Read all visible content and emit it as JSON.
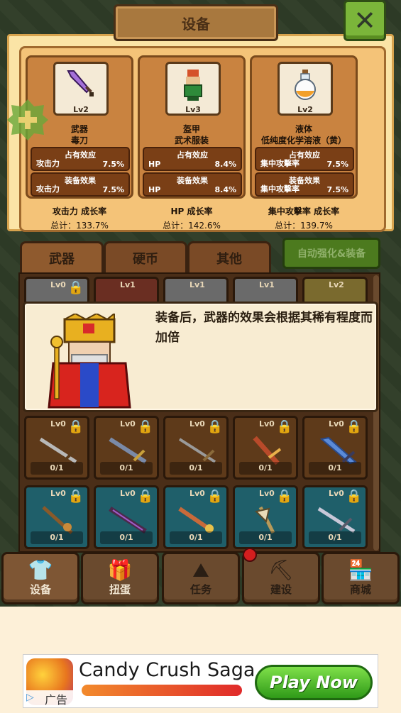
{
  "header": {
    "title": "设备",
    "close_icon": "close-icon"
  },
  "equip": [
    {
      "icon": "dagger-icon",
      "level": "Lv2",
      "type": "武器",
      "name": "毒刀",
      "possess_header": "占有效应",
      "possess_key": "攻击力",
      "possess_value": "7.5%",
      "equip_header": "装备效果",
      "equip_key": "攻击力",
      "equip_value": "7.5%",
      "growth_label": "攻击力 成长率",
      "total": "总计：133.7%"
    },
    {
      "icon": "armor-icon",
      "level": "Lv3",
      "type": "盔甲",
      "name": "武术服装",
      "possess_header": "占有效应",
      "possess_key": "HP",
      "possess_value": "8.4%",
      "equip_header": "装备效果",
      "equip_key": "HP",
      "equip_value": "8.4%",
      "growth_label": "HP 成长率",
      "total": "总计：142.6%"
    },
    {
      "icon": "potion-icon",
      "level": "Lv2",
      "type": "液体",
      "name": "低纯度化学溶液（黄）",
      "possess_header": "占有效应",
      "possess_key": "集中攻擊率",
      "possess_value": "7.5%",
      "equip_header": "装备效果",
      "equip_key": "集中攻擊率",
      "equip_value": "7.5%",
      "growth_label": "集中攻擊率 成长率",
      "total": "总计：139.7%"
    }
  ],
  "tabs": [
    {
      "label": "武器"
    },
    {
      "label": "硬币"
    },
    {
      "label": "其他"
    }
  ],
  "auto_button": "自动强化&装备",
  "top_row_levels": [
    "Lv0",
    "Lv1",
    "Lv1",
    "Lv1",
    "Lv2"
  ],
  "grid": {
    "row1": [
      {
        "level": "Lv0",
        "count": "0/1"
      },
      {
        "level": "Lv0",
        "count": "0/1"
      },
      {
        "level": "Lv0",
        "count": "0/1"
      },
      {
        "level": "Lv0",
        "count": "0/1"
      },
      {
        "level": "Lv0",
        "count": "0/1"
      }
    ],
    "row2": [
      {
        "level": "Lv0",
        "count": "0/1"
      },
      {
        "level": "Lv0",
        "count": "0/1"
      },
      {
        "level": "Lv0",
        "count": "0/1"
      },
      {
        "level": "Lv0",
        "count": "0/1"
      },
      {
        "level": "Lv0",
        "count": "0/1"
      }
    ]
  },
  "dialog": {
    "text": "装备后，武器的效果会根据其稀有程度而加倍",
    "character_icon": "king-icon"
  },
  "nav": [
    {
      "label": "设备",
      "icon": "shirt-icon"
    },
    {
      "label": "扭蛋",
      "icon": "gift-icon"
    },
    {
      "label": "任务",
      "icon": "map-icon"
    },
    {
      "label": "建设",
      "icon": "worker-icon"
    },
    {
      "label": "商城",
      "icon": "shop-icon"
    }
  ],
  "ad": {
    "title": "Candy Crush Saga",
    "cta": "Play Now",
    "label": "广告"
  },
  "colors": {
    "panel": "#f4c378",
    "card": "#c98340",
    "close_green": "#7bb53a",
    "auto_green": "#4c7a1e",
    "teal_slot": "#1f5f6a"
  }
}
